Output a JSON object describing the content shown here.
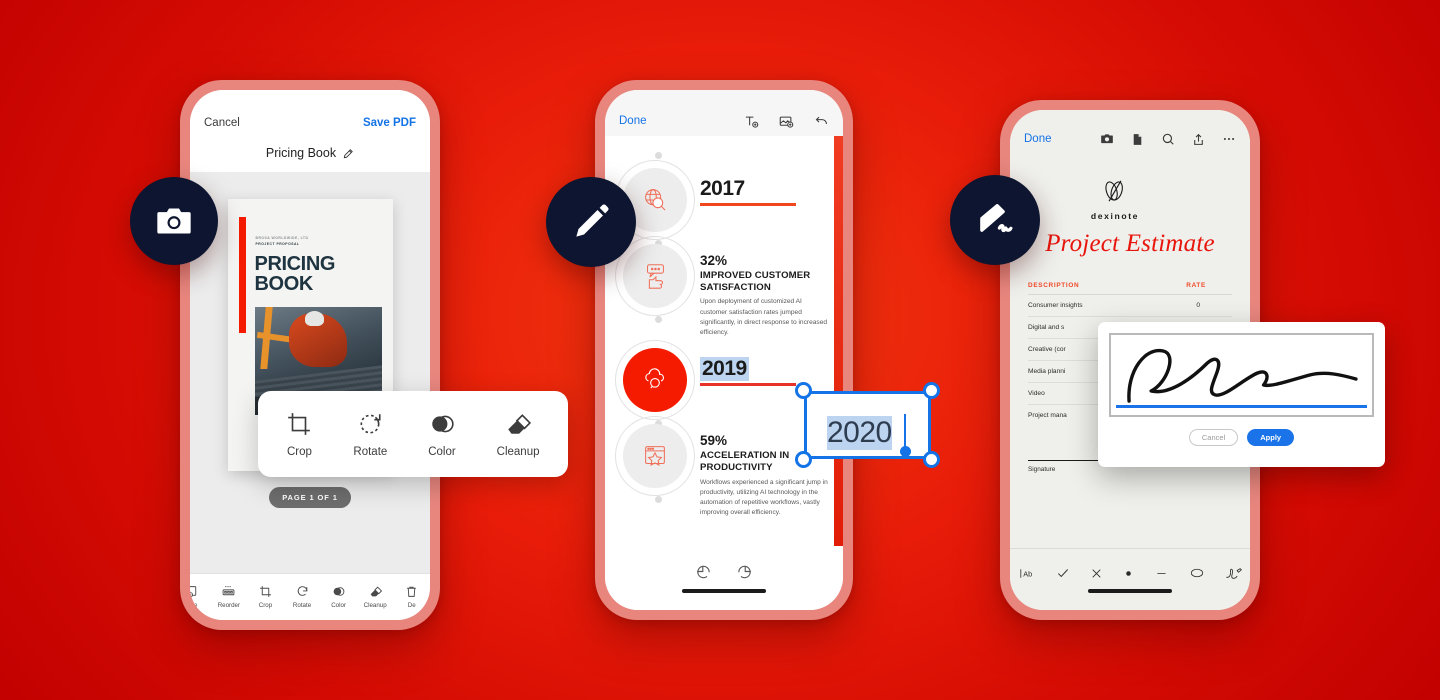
{
  "background": {
    "accent_red": "#e81c09",
    "phone_frame": "#e8867e",
    "badge_bg": "#0d1530"
  },
  "badges": [
    {
      "name": "camera-badge",
      "icon": "camera-icon"
    },
    {
      "name": "edit-badge",
      "icon": "pencil-icon"
    },
    {
      "name": "sign-badge",
      "icon": "signature-icon"
    }
  ],
  "phone_left": {
    "nav": {
      "cancel": "Cancel",
      "save": "Save PDF",
      "save_color": "#1473e6"
    },
    "doc_title": "Pricing Book",
    "cover": {
      "kicker_line1": "BROSA WORLDWIDE, LTD",
      "kicker_line2": "PROJECT PROPOSAL",
      "title_line1": "PRICING",
      "title_line2": "BOOK"
    },
    "page_indicator": "PAGE 1 OF 1",
    "popover": {
      "items": [
        {
          "label": "Crop",
          "icon": "crop-icon"
        },
        {
          "label": "Rotate",
          "icon": "rotate-icon"
        },
        {
          "label": "Color",
          "icon": "color-icon"
        },
        {
          "label": "Cleanup",
          "icon": "eraser-icon"
        }
      ]
    },
    "tabbar": {
      "items": [
        {
          "label": "age",
          "icon": "add-page-icon"
        },
        {
          "label": "Reorder",
          "icon": "reorder-icon"
        },
        {
          "label": "Crop",
          "icon": "crop-icon"
        },
        {
          "label": "Rotate",
          "icon": "rotate-icon"
        },
        {
          "label": "Color",
          "icon": "color-icon"
        },
        {
          "label": "Cleanup",
          "icon": "eraser-icon"
        },
        {
          "label": "De",
          "icon": "trash-icon"
        }
      ]
    }
  },
  "phone_center": {
    "nav": {
      "done": "Done",
      "done_color": "#1473e6",
      "icons": [
        "add-text-icon",
        "add-image-icon",
        "undo-icon"
      ]
    },
    "timeline": [
      {
        "year": "2017",
        "pct": "",
        "head": "",
        "body": "",
        "icon": "globe-search-icon",
        "accent": false,
        "has_underline": true
      },
      {
        "year": "",
        "pct": "32%",
        "head": "IMPROVED CUSTOMER SATISFACTION",
        "body": "Upon deployment of customized AI customer satisfaction rates jumped significantly, in direct response to increased efficiency.",
        "icon": "thumbs-up-icon",
        "accent": false,
        "has_underline": false
      },
      {
        "year": "2019",
        "pct": "",
        "head": "",
        "body": "",
        "icon": "cloud-icon",
        "accent": true,
        "has_underline": true
      },
      {
        "year": "",
        "pct": "59%",
        "head": "ACCELERATION IN PRODUCTIVITY",
        "body": "Workflows experienced a significant jump in productivity, utilizing AI technology in the automation of repetitive workflows, vastly improving overall efficiency.",
        "icon": "star-window-icon",
        "accent": false,
        "has_underline": false
      }
    ],
    "selected_textbox": {
      "value": "2020",
      "selected": true,
      "handle_color": "#1473e6"
    },
    "bottom": {
      "icons": [
        "undo-icon",
        "redo-icon"
      ]
    }
  },
  "phone_right": {
    "nav": {
      "done": "Done",
      "done_color": "#1473e6",
      "icons": [
        "camera-icon",
        "document-icon",
        "search-icon",
        "share-icon",
        "more-icon"
      ]
    },
    "logo_name": "dexinote",
    "title": "Project Estimate",
    "table": {
      "headers": [
        "DESCRIPTION",
        "RATE"
      ],
      "rows": [
        {
          "description": "Consumer insights",
          "rate": "0"
        },
        {
          "description": "Digital and s",
          "rate": ""
        },
        {
          "description": "Creative (cor",
          "rate": ""
        },
        {
          "description": "Media planni",
          "rate": ""
        },
        {
          "description": "Video",
          "rate": ""
        },
        {
          "description": "Project mana",
          "rate": ""
        }
      ]
    },
    "signature_label": "Signature",
    "tabbar": {
      "icons": [
        "text-icon",
        "check-icon",
        "cross-icon",
        "dot-icon",
        "line-icon",
        "oval-icon",
        "signature-icon"
      ]
    },
    "signature_dialog": {
      "cancel": "Cancel",
      "apply": "Apply",
      "apply_color": "#1a73e8"
    }
  }
}
